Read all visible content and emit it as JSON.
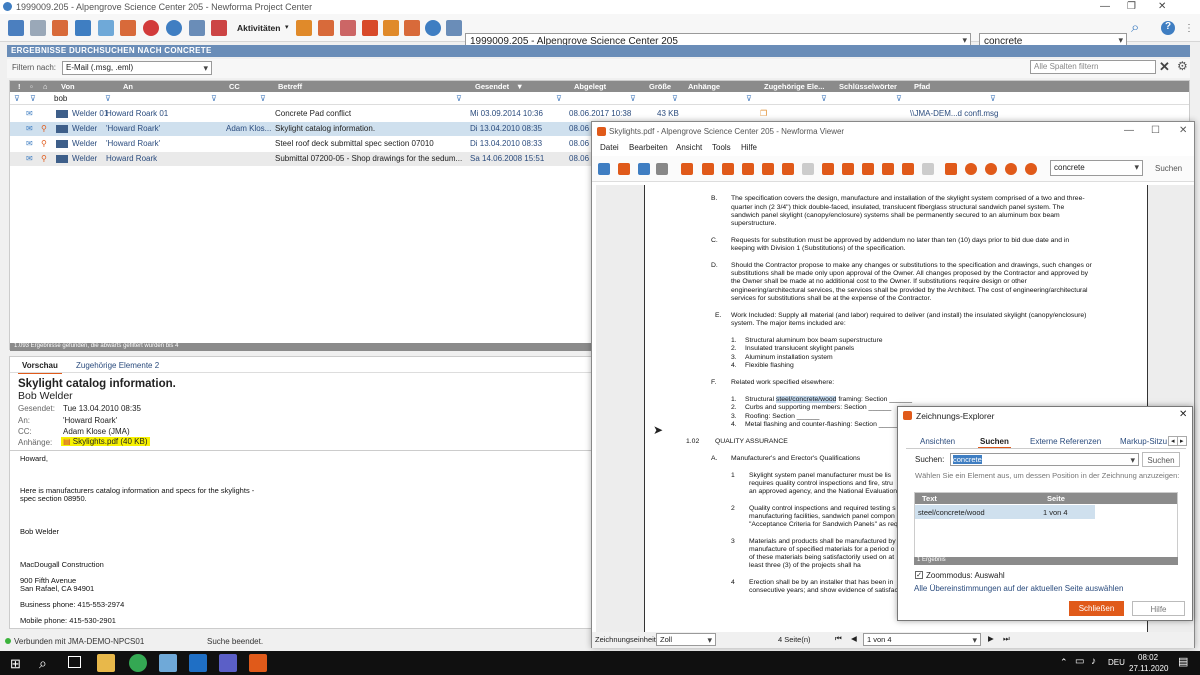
{
  "window": {
    "title": "1999009.205 - Alpengrove Science Center 205 - Newforma Project Center"
  },
  "toolbar": {
    "activities_label": "Aktivitäten",
    "project_value": "1999009.205 - Alpengrove Science Center 205",
    "search_value": "concrete"
  },
  "search_header": "ERGEBNISSE DURCHSUCHEN NACH CONCRETE",
  "filter": {
    "label": "Filtern nach:",
    "value": "E-Mail (.msg, .eml)",
    "column_placeholder": "Alle Spalten filtern"
  },
  "grid": {
    "columns": [
      "Von",
      "An",
      "CC",
      "Betreff",
      "Gesendet",
      "Abgelegt",
      "Größe",
      "Anhänge",
      "Zugehörige Ele...",
      "Schlüsselwörter",
      "Pfad"
    ],
    "from_filter": "bob",
    "rows": [
      {
        "from": "Welder 01",
        "to": "Howard Roark 01",
        "cc": "",
        "subject": "Concrete Pad conflict",
        "sent": "Mi 03.09.2014 10:36",
        "filed": "08.06.2017 10:38",
        "size": "43 KB",
        "path": "\\\\JMA-DEM...d confl.msg"
      },
      {
        "from": "Welder",
        "to": "'Howard Roark'",
        "cc": "Adam Klos...",
        "subject": "Skylight catalog information.",
        "sent": "Di 13.04.2010 08:35",
        "filed": "08.06",
        "size": "",
        "path": ""
      },
      {
        "from": "Welder",
        "to": "'Howard Roark'",
        "cc": "",
        "subject": "Steel roof deck submittal spec section 07010",
        "sent": "Di 13.04.2010 08:33",
        "filed": "08.06",
        "size": "",
        "path": ""
      },
      {
        "from": "Welder",
        "to": "Howard Roark",
        "cc": "",
        "subject": "Submittal 07200-05 - Shop drawings for the sedum...",
        "sent": "Sa 14.06.2008 15:51",
        "filed": "08.06",
        "size": "",
        "path": ""
      }
    ],
    "status": "1.093 Ergebnisse gefunden, die abwärts gefiltert wurden bis 4"
  },
  "preview": {
    "tabs": [
      "Vorschau",
      "Zugehörige Elemente 2"
    ],
    "subject": "Skylight catalog information.",
    "sender": "Bob Welder",
    "sent_label": "Gesendet:",
    "sent": "Tue 13.04.2010 08:35",
    "to_label": "An:",
    "to": "'Howard Roark'",
    "cc_label": "CC:",
    "cc": "Adam Klose (JMA)",
    "att_label": "Anhänge:",
    "attachment": "Skylights.pdf (40 KB)",
    "body": [
      "Howard,",
      "Here is manufacturers catalog information and specs for the skylights -",
      "spec section 08950.",
      "Bob Welder",
      "MacDougall Construction",
      "900 Fifth Avenue",
      "San Rafael, CA 94901",
      "Business phone:  415-553-2974",
      "Mobile phone:  415-530-2901"
    ]
  },
  "statusbar": {
    "connection": "Verbunden mit JMA-DEMO-NPCS01",
    "message": "Suche beendet."
  },
  "viewer": {
    "title": "Skylights.pdf - Alpengrove Science Center 205 - Newforma Viewer",
    "menu": [
      "Datei",
      "Bearbeiten",
      "Ansicht",
      "Tools",
      "Hilfe"
    ],
    "search_value": "concrete",
    "search_button": "Suchen",
    "doc_lines": [
      "B.",
      "The specification covers the design, manufacture and installation of the skylight system comprised of a two and three-",
      "quarter inch (2 3/4\") thick double-faced, insulated, translucent fiberglass structural sandwich panel system.  The",
      "sandwich panel skylight (canopy/enclosure) systems shall be permanently secured to an aluminum box beam",
      "superstructure.",
      "C.",
      "Requests for substitution must be approved by addendum no later than ten (10) days prior to bid due date and in",
      "keeping with Division 1 (Substitutions) of the specification.",
      "D.",
      "Should the Contractor propose to make any changes or substitutions to the specification and drawings, such changes or",
      "substitutions shall be made only upon approval of the Owner.  All changes proposed by the Contractor and approved by",
      "the Owner shall be made at no additional cost to the Owner.  If substitutions require design or other",
      "engineering/architectural services, the services shall be provided by the Architect.  The cost of engineering/architectural",
      "services for substitutions shall be at the expense of the Contractor.",
      "E.",
      "Work Included:  Supply all material (and labor) required to deliver (and install) the insulated skylight (canopy/enclosure)",
      "system. The major items included are:",
      "1.",
      "Structural aluminum box beam superstructure",
      "2.",
      "Insulated translucent skylight panels",
      "3.",
      "Aluminum installation system",
      "4.",
      "Flexible flashing",
      "F.",
      "Related work specified elsewhere:",
      "1.",
      "Structural ",
      "steel/concrete/wood",
      " framing:  Section ______",
      "2.",
      "Curbs and supporting members:  Section ______",
      "3.",
      "Roofing:  Section ______",
      "4.",
      "Metal flashing and counter-flashing:  Section ______",
      "1.02",
      "QUALITY ASSURANCE",
      "A.",
      "Manufacturer's and Erector's Qualifications",
      "1",
      "Skylight system panel manufacturer must be lis",
      "requires quality control inspections and fire, stru",
      "an approved agency, and the National Evaluation",
      "2",
      "Quality control inspections and required testing s",
      "manufacturing facilities, sandwich panel compon",
      "\"Acceptance Criteria for Sandwich Panels\" as req",
      "3",
      "Materials and products shall be manufactured by",
      "manufacture of specified materials for a period o",
      "of these materials being satisfactorily used on at",
      "least three (3) of the projects shall ha",
      "4",
      "Erection shall be by an installer that has been in",
      "consecutive years; and show evidence of satisfac"
    ],
    "unit_label": "Zeichnungseinheit",
    "unit_value": "Zoll",
    "pages": "4 Seite(n)",
    "page_value": "1 von 4"
  },
  "dialog": {
    "title": "Zeichnungs-Explorer",
    "tabs": [
      "Ansichten",
      "Suchen",
      "Externe Referenzen",
      "Markup-Sitzu"
    ],
    "search_label": "Suchen:",
    "search_value": "concrete",
    "search_button": "Suchen",
    "hint": "Wählen Sie ein Element aus, um dessen Position in der Zeichnung anzuzeigen:",
    "col_text": "Text",
    "col_page": "Seite",
    "results": [
      {
        "text": "steel/concrete/wood",
        "page": "1 von 4"
      }
    ],
    "result_count": "1 Ergebnis",
    "zoom_label": "Zoommodus: Auswahl",
    "select_all": "Alle Übereinstimmungen auf der aktuellen Seite auswählen",
    "close_button": "Schließen",
    "help_button": "Hilfe"
  },
  "taskbar": {
    "lang": "DEU",
    "time": "08:02",
    "date": "27.11.2020"
  }
}
